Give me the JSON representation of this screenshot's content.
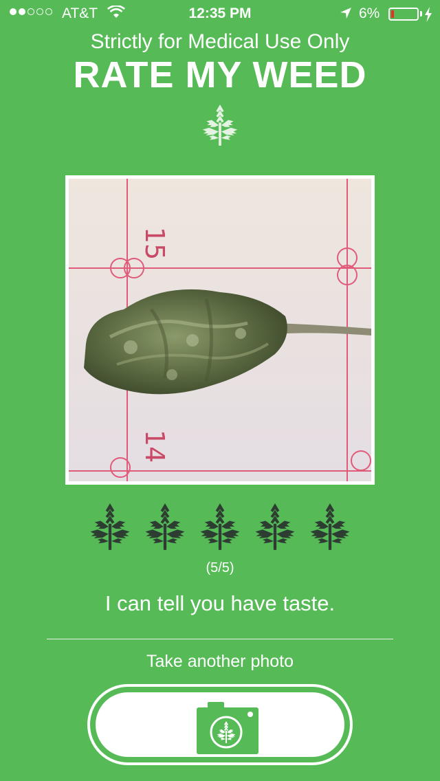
{
  "status_bar": {
    "carrier": "AT&T",
    "time": "12:35 PM",
    "battery_percent": "6%",
    "signal_bars": 2,
    "signal_total": 5,
    "battery_level": 0.06,
    "battery_low_color": "#e8302a"
  },
  "header": {
    "subtitle": "Strictly for Medical Use Only",
    "title": "RATE MY WEED",
    "logo_icon": "cannabis-leaf-icon"
  },
  "result": {
    "rating_icon": "cannabis-leaf-icon",
    "rating_value": 5,
    "rating_max": 5,
    "rating_text": "(5/5)",
    "message": "I can tell you have taste."
  },
  "action": {
    "label": "Take another photo",
    "button_icon": "camera-icon"
  },
  "colors": {
    "background": "#56bb57",
    "leaf_dark": "#2d3d32",
    "camera_green": "#56bb57"
  }
}
